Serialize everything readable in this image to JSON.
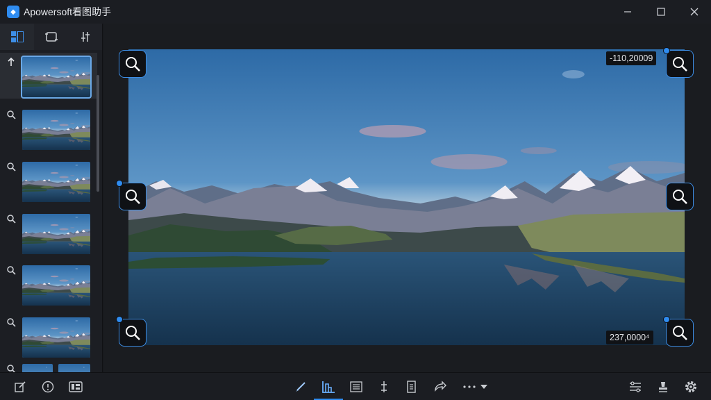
{
  "window": {
    "title": "Apowersoft看图助手",
    "controls": [
      "minimize-icon",
      "maximize-icon",
      "close-icon"
    ]
  },
  "left_panel": {
    "tabs": [
      {
        "icon": "grid-thumbnail-icon",
        "active": true
      },
      {
        "icon": "crop-frame-icon",
        "active": false
      },
      {
        "icon": "adjust-sliders-icon",
        "active": false
      }
    ],
    "thumbnails": [
      {
        "lead_icon": "up-arrow-icon",
        "selected": true
      },
      {
        "lead_icon": "search-icon",
        "selected": false
      },
      {
        "lead_icon": "search-icon",
        "selected": false
      },
      {
        "lead_icon": "search-icon",
        "selected": false
      },
      {
        "lead_icon": "search-icon",
        "selected": false
      },
      {
        "lead_icon": "search-icon",
        "selected": false
      },
      {
        "lead_icon": "search-icon",
        "selected": false
      }
    ]
  },
  "viewer": {
    "coord_top_right": "-110,20009",
    "coord_bottom_right": "237,0000⁴",
    "zoom_handles": [
      "top-left",
      "top-right",
      "middle-left",
      "middle-right",
      "bottom-left",
      "bottom-right"
    ]
  },
  "bottom_toolbar": {
    "left": [
      "edit-icon",
      "info-icon",
      "slideshow-icon"
    ],
    "center": [
      "brush-icon",
      "histogram-icon",
      "list-icon",
      "anchor-icon",
      "document-icon",
      "share-icon",
      "more-icon"
    ],
    "active": "histogram-icon",
    "right": [
      "sliders-icon",
      "stamp-icon",
      "settings-icon"
    ]
  },
  "colors": {
    "accent": "#2f8cf0",
    "background": "#16181d",
    "panel": "#1c1e23"
  }
}
